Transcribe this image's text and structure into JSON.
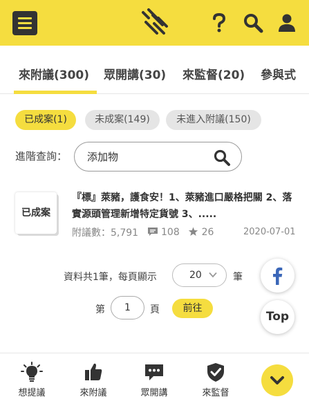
{
  "header": {
    "menu_icon": "hamburger-menu-icon",
    "logo_icon": "hand-logo-icon",
    "help_icon": "question-mark-icon",
    "search_icon": "search-icon",
    "user_icon": "user-icon",
    "accent_color": "#f5dd3f"
  },
  "tabs": [
    {
      "label": "來附議(300)",
      "active": true
    },
    {
      "label": "眾開講(30)",
      "active": false
    },
    {
      "label": "來監督(20)",
      "active": false
    },
    {
      "label": "參與式",
      "active": false
    }
  ],
  "filters": [
    {
      "label": "已成案(1)",
      "active": true
    },
    {
      "label": "未成案(149)",
      "active": false
    },
    {
      "label": "未進入附議(150)",
      "active": false
    }
  ],
  "search": {
    "label": "進階查詢：",
    "value": "添加物",
    "icon": "search-icon"
  },
  "results": [
    {
      "status": "已成案",
      "title": "『標』萊豬，護食安！1、萊豬進口嚴格把關 2、落實源頭管理新增特定貨號 3、.....",
      "sign_label": "附議數：",
      "sign_count": "5,791",
      "comments": "108",
      "stars": "26",
      "date": "2020-07-01"
    }
  ],
  "pagination": {
    "summary": "資料共1筆，每頁顯示",
    "per_page": "20",
    "per_page_unit": "筆",
    "page_prefix": "第",
    "page": "1",
    "page_suffix": "頁",
    "go_label": "前往"
  },
  "floating": {
    "facebook_icon": "facebook-icon",
    "top_label": "Top"
  },
  "bottom_nav": [
    {
      "label": "想提議",
      "icon": "lightbulb-icon"
    },
    {
      "label": "來附議",
      "icon": "thumbs-up-icon"
    },
    {
      "label": "眾開講",
      "icon": "speech-bubble-icon"
    },
    {
      "label": "來監督",
      "icon": "shield-check-icon"
    }
  ],
  "expand_icon": "chevron-down-icon"
}
